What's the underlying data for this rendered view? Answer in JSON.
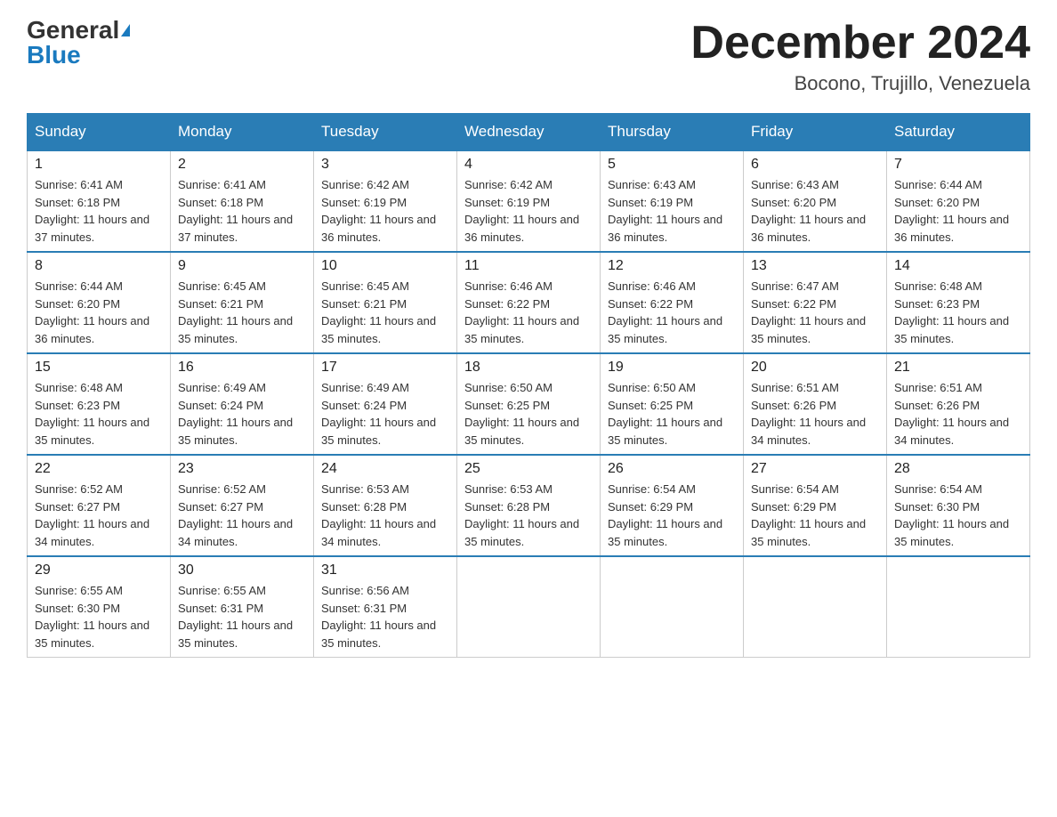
{
  "header": {
    "logo_general": "General",
    "logo_blue": "Blue",
    "month_title": "December 2024",
    "location": "Bocono, Trujillo, Venezuela"
  },
  "days_of_week": [
    "Sunday",
    "Monday",
    "Tuesday",
    "Wednesday",
    "Thursday",
    "Friday",
    "Saturday"
  ],
  "weeks": [
    [
      {
        "day": "1",
        "sunrise": "6:41 AM",
        "sunset": "6:18 PM",
        "daylight": "11 hours and 37 minutes."
      },
      {
        "day": "2",
        "sunrise": "6:41 AM",
        "sunset": "6:18 PM",
        "daylight": "11 hours and 37 minutes."
      },
      {
        "day": "3",
        "sunrise": "6:42 AM",
        "sunset": "6:19 PM",
        "daylight": "11 hours and 36 minutes."
      },
      {
        "day": "4",
        "sunrise": "6:42 AM",
        "sunset": "6:19 PM",
        "daylight": "11 hours and 36 minutes."
      },
      {
        "day": "5",
        "sunrise": "6:43 AM",
        "sunset": "6:19 PM",
        "daylight": "11 hours and 36 minutes."
      },
      {
        "day": "6",
        "sunrise": "6:43 AM",
        "sunset": "6:20 PM",
        "daylight": "11 hours and 36 minutes."
      },
      {
        "day": "7",
        "sunrise": "6:44 AM",
        "sunset": "6:20 PM",
        "daylight": "11 hours and 36 minutes."
      }
    ],
    [
      {
        "day": "8",
        "sunrise": "6:44 AM",
        "sunset": "6:20 PM",
        "daylight": "11 hours and 36 minutes."
      },
      {
        "day": "9",
        "sunrise": "6:45 AM",
        "sunset": "6:21 PM",
        "daylight": "11 hours and 35 minutes."
      },
      {
        "day": "10",
        "sunrise": "6:45 AM",
        "sunset": "6:21 PM",
        "daylight": "11 hours and 35 minutes."
      },
      {
        "day": "11",
        "sunrise": "6:46 AM",
        "sunset": "6:22 PM",
        "daylight": "11 hours and 35 minutes."
      },
      {
        "day": "12",
        "sunrise": "6:46 AM",
        "sunset": "6:22 PM",
        "daylight": "11 hours and 35 minutes."
      },
      {
        "day": "13",
        "sunrise": "6:47 AM",
        "sunset": "6:22 PM",
        "daylight": "11 hours and 35 minutes."
      },
      {
        "day": "14",
        "sunrise": "6:48 AM",
        "sunset": "6:23 PM",
        "daylight": "11 hours and 35 minutes."
      }
    ],
    [
      {
        "day": "15",
        "sunrise": "6:48 AM",
        "sunset": "6:23 PM",
        "daylight": "11 hours and 35 minutes."
      },
      {
        "day": "16",
        "sunrise": "6:49 AM",
        "sunset": "6:24 PM",
        "daylight": "11 hours and 35 minutes."
      },
      {
        "day": "17",
        "sunrise": "6:49 AM",
        "sunset": "6:24 PM",
        "daylight": "11 hours and 35 minutes."
      },
      {
        "day": "18",
        "sunrise": "6:50 AM",
        "sunset": "6:25 PM",
        "daylight": "11 hours and 35 minutes."
      },
      {
        "day": "19",
        "sunrise": "6:50 AM",
        "sunset": "6:25 PM",
        "daylight": "11 hours and 35 minutes."
      },
      {
        "day": "20",
        "sunrise": "6:51 AM",
        "sunset": "6:26 PM",
        "daylight": "11 hours and 34 minutes."
      },
      {
        "day": "21",
        "sunrise": "6:51 AM",
        "sunset": "6:26 PM",
        "daylight": "11 hours and 34 minutes."
      }
    ],
    [
      {
        "day": "22",
        "sunrise": "6:52 AM",
        "sunset": "6:27 PM",
        "daylight": "11 hours and 34 minutes."
      },
      {
        "day": "23",
        "sunrise": "6:52 AM",
        "sunset": "6:27 PM",
        "daylight": "11 hours and 34 minutes."
      },
      {
        "day": "24",
        "sunrise": "6:53 AM",
        "sunset": "6:28 PM",
        "daylight": "11 hours and 34 minutes."
      },
      {
        "day": "25",
        "sunrise": "6:53 AM",
        "sunset": "6:28 PM",
        "daylight": "11 hours and 35 minutes."
      },
      {
        "day": "26",
        "sunrise": "6:54 AM",
        "sunset": "6:29 PM",
        "daylight": "11 hours and 35 minutes."
      },
      {
        "day": "27",
        "sunrise": "6:54 AM",
        "sunset": "6:29 PM",
        "daylight": "11 hours and 35 minutes."
      },
      {
        "day": "28",
        "sunrise": "6:54 AM",
        "sunset": "6:30 PM",
        "daylight": "11 hours and 35 minutes."
      }
    ],
    [
      {
        "day": "29",
        "sunrise": "6:55 AM",
        "sunset": "6:30 PM",
        "daylight": "11 hours and 35 minutes."
      },
      {
        "day": "30",
        "sunrise": "6:55 AM",
        "sunset": "6:31 PM",
        "daylight": "11 hours and 35 minutes."
      },
      {
        "day": "31",
        "sunrise": "6:56 AM",
        "sunset": "6:31 PM",
        "daylight": "11 hours and 35 minutes."
      },
      null,
      null,
      null,
      null
    ]
  ]
}
